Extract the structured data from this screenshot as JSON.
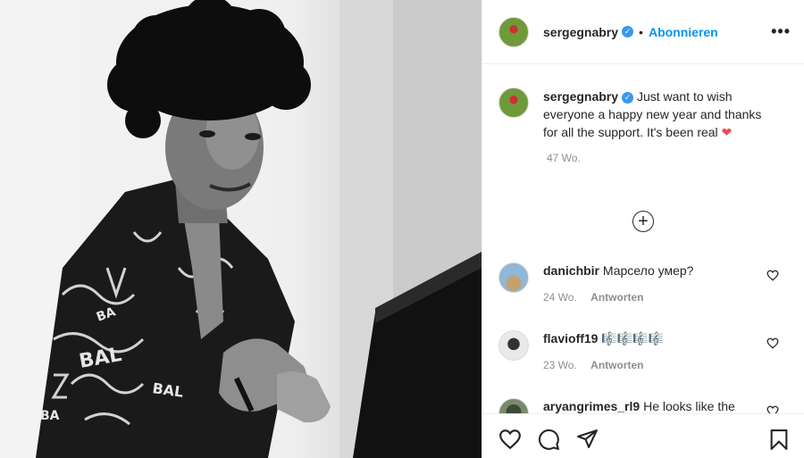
{
  "post": {
    "username": "sergegnabry",
    "follow_label": "Abonnieren",
    "separator": "•",
    "more_label": "•••"
  },
  "caption": {
    "username": "sergegnabry",
    "text": "Just want to wish everyone a happy new year and thanks for all the support. It's been real",
    "emoji": "❤",
    "age": "47 Wo."
  },
  "load_more_label": "+",
  "comments": [
    {
      "username": "danichbir",
      "text": "Марсело умер?",
      "age": "24 Wo.",
      "reply_label": "Antworten"
    },
    {
      "username": "flavioff19",
      "text": "🎼🎼🎼🎼",
      "age": "23 Wo.",
      "reply_label": "Antworten"
    },
    {
      "username": "aryangrimes_rl9",
      "text": "He looks like the",
      "age": "",
      "reply_label": ""
    }
  ],
  "colors": {
    "link_blue": "#0095f6",
    "verified_blue": "#3897f0",
    "heart_red": "#ed4956"
  }
}
